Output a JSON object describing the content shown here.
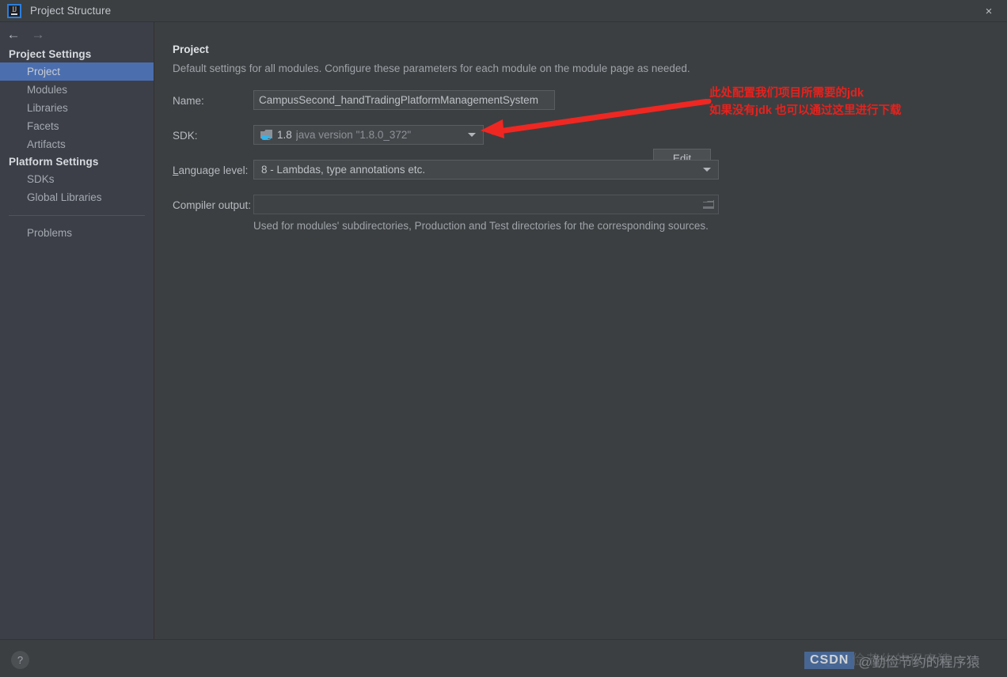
{
  "window": {
    "title": "Project Structure",
    "logo_text": "IJ",
    "close_label": "×"
  },
  "nav": {
    "back_icon": "←",
    "forward_icon": "→"
  },
  "sidebar": {
    "groups": [
      {
        "header": "Project Settings",
        "items": [
          {
            "label": "Project",
            "selected": true
          },
          {
            "label": "Modules",
            "selected": false
          },
          {
            "label": "Libraries",
            "selected": false
          },
          {
            "label": "Facets",
            "selected": false
          },
          {
            "label": "Artifacts",
            "selected": false
          }
        ]
      },
      {
        "header": "Platform Settings",
        "items": [
          {
            "label": "SDKs",
            "selected": false
          },
          {
            "label": "Global Libraries",
            "selected": false
          }
        ]
      }
    ],
    "problems_item": "Problems"
  },
  "main": {
    "title": "Project",
    "subtitle": "Default settings for all modules. Configure these parameters for each module on the module page as needed.",
    "name": {
      "label": "Name:",
      "value": "CampusSecond_handTradingPlatformManagementSystem",
      "placeholder": ""
    },
    "sdk": {
      "label": "SDK:",
      "icon": "jdk-folder-icon",
      "version": "1.8",
      "description": "java version \"1.8.0_372\"",
      "edit_button": "Edit",
      "edit_mnemonic": "E"
    },
    "language_level": {
      "label": "Language level:",
      "label_mnemonic": "L",
      "value": "8 - Lambdas, type annotations etc."
    },
    "compiler_output": {
      "label": "Compiler output:",
      "value": "",
      "placeholder": "",
      "browse_icon": "folder-icon",
      "hint": "Used for modules' subdirectories, Production and Test directories for the corresponding sources."
    }
  },
  "annotation": {
    "line1": "此处配置我们项目所需要的jdk",
    "line2": "如果没有jdk 也可以通过这里进行下载",
    "color": "#e8211d"
  },
  "footer": {
    "help_label": "?"
  },
  "watermark": {
    "badge": "CSDN",
    "user": "@勤俭节约的程序猿",
    "ghost": "@勤俭节约的程序猿",
    "badge_color": "#4a6fa5"
  },
  "colors": {
    "accent": "#4b6eaf",
    "panel_bg": "#3c3f41",
    "sidebar_bg": "#3c3f48",
    "text": "#b6bac0",
    "annotation_red": "#e8211d"
  }
}
